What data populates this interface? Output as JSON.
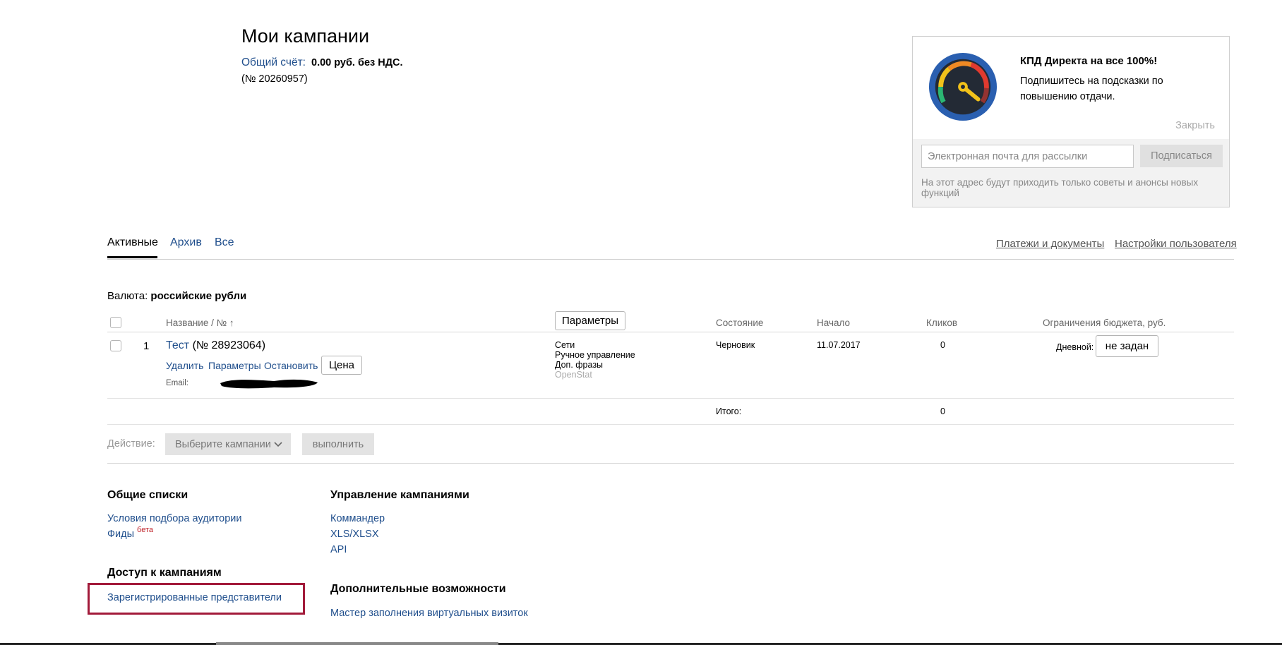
{
  "header": {
    "title": "Мои кампании",
    "account_link": "Общий счёт:",
    "account_amount": "0.00 руб. без НДС.",
    "account_number": "(№ 20260957)"
  },
  "promo": {
    "title": "КПД Директа на все 100%!",
    "text": "Подпишитесь на подсказки по повышению отдачи.",
    "close_label": "Закрыть",
    "email_placeholder": "Электронная почта для рассылки",
    "subscribe_label": "Подписаться",
    "note": "На этот адрес будут приходить только советы и анонсы новых функций",
    "gauge_colors": [
      "#2a5fb0",
      "#e03a2f",
      "#f08a24",
      "#f2c21a",
      "#2bb673",
      "#232a35"
    ]
  },
  "tabs": [
    {
      "label": "Активные",
      "active": true
    },
    {
      "label": "Архив",
      "active": false
    },
    {
      "label": "Все",
      "active": false
    }
  ],
  "top_links": {
    "payments": "Платежи и документы",
    "settings": "Настройки пользователя"
  },
  "currency": {
    "label": "Валюта:",
    "value": "российские рубли"
  },
  "table": {
    "headers": {
      "name": "Название / №",
      "sort_arrow": "↑",
      "params_button": "Параметры",
      "state": "Состояние",
      "start": "Начало",
      "clicks": "Кликов",
      "budget": "Ограничения бюджета, руб."
    },
    "rows": [
      {
        "index": "1",
        "name": "Тест",
        "number": "(№ 28923064)",
        "actions": [
          "Удалить",
          "Параметры",
          "Остановить"
        ],
        "price_button": "Цена",
        "email_label": "Email:",
        "targeting": [
          "Сети",
          "Ручное управление",
          "Доп. фразы"
        ],
        "targeting_extra": "OpenStat",
        "state": "Черновик",
        "start": "11.07.2017",
        "clicks": "0",
        "budget_label": "Дневной:",
        "budget_value": "не задан"
      }
    ],
    "total_label": "Итого:",
    "total_clicks": "0"
  },
  "action_bar": {
    "label": "Действие:",
    "select_placeholder": "Выберите кампании",
    "execute_label": "выполнить"
  },
  "footer": {
    "general_lists": {
      "heading": "Общие списки",
      "links": [
        "Условия подбора аудитории",
        "Фиды"
      ],
      "beta_label": "бета"
    },
    "campaign_mgmt": {
      "heading": "Управление кампаниями",
      "links": [
        "Коммандер",
        "XLS/XLSX",
        "API"
      ]
    },
    "access": {
      "heading": "Доступ к кампаниям",
      "links": [
        "Зарегистрированные представители"
      ]
    },
    "extra": {
      "heading": "Дополнительные возможности",
      "links": [
        "Мастер заполнения виртуальных визиток"
      ]
    }
  }
}
